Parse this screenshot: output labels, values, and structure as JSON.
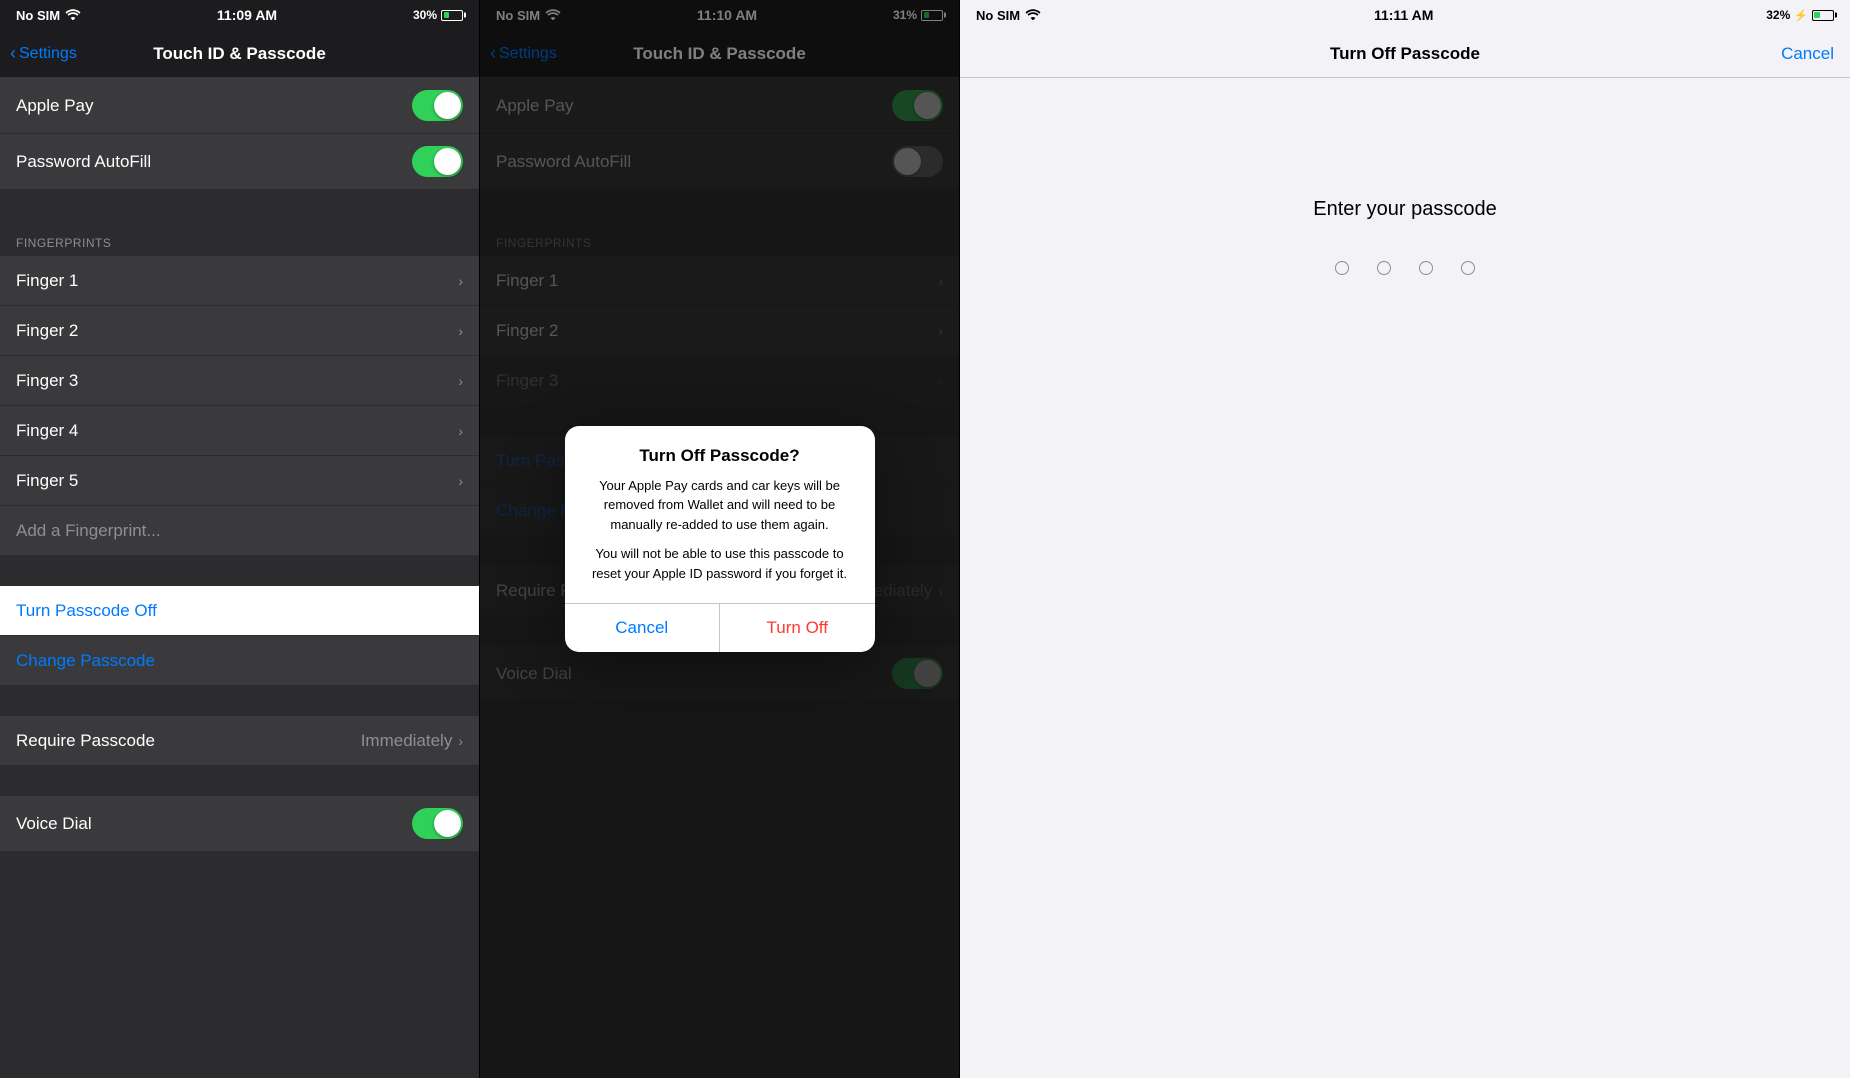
{
  "panel1": {
    "status": {
      "left": "No SIM",
      "time": "11:09 AM",
      "battery": "30%"
    },
    "nav": {
      "back": "Settings",
      "title": "Touch ID & Passcode"
    },
    "toggles": {
      "apple_pay": {
        "label": "Apple Pay",
        "on": true
      },
      "password_autofill": {
        "label": "Password AutoFill",
        "on": true
      }
    },
    "fingerprints_header": "FINGERPRINTS",
    "fingerprints": [
      "Finger 1",
      "Finger 2",
      "Finger 3",
      "Finger 4",
      "Finger 5"
    ],
    "add_fingerprint": "Add a Fingerprint...",
    "turn_passcode_off": "Turn Passcode Off",
    "change_passcode": "Change Passcode",
    "require_passcode": {
      "label": "Require Passcode",
      "value": "Immediately"
    },
    "voice_dial": {
      "label": "Voice Dial",
      "on": true
    }
  },
  "panel2": {
    "status": {
      "left": "No SIM",
      "time": "11:10 AM",
      "battery": "31%"
    },
    "nav": {
      "back": "Settings",
      "title": "Touch ID & Passcode"
    },
    "toggles": {
      "apple_pay": {
        "label": "Apple Pay",
        "on": true
      },
      "password_autofill": {
        "label": "Password AutoFill",
        "on": false
      }
    },
    "fingerprints_header": "FINGERPRINTS",
    "fingerprints": [
      "Finger 1",
      "Finger 2"
    ],
    "turn_passcode_off": "Turn Passcode Off",
    "change_passcode": "Change Passcode",
    "require_passcode": {
      "label": "Require Passcode",
      "value": "Immediately"
    },
    "voice_dial": {
      "label": "Voice Dial",
      "on": true
    }
  },
  "modal": {
    "title": "Turn Off Passcode?",
    "message1": "Your Apple Pay cards and car keys will be removed from Wallet and will need to be manually re-added to use them again.",
    "message2": "You will not be able to use this passcode to reset your Apple ID password if you forget it.",
    "cancel": "Cancel",
    "turn_off": "Turn Off"
  },
  "panel3": {
    "status": {
      "left": "No SIM",
      "time": "11:11 AM",
      "battery": "32%"
    },
    "nav": {
      "title": "Turn Off Passcode",
      "cancel": "Cancel"
    },
    "prompt": "Enter your passcode",
    "dots": 4
  },
  "icons": {
    "back_chevron": "‹",
    "chevron_right": "›",
    "wifi": "▲",
    "battery_charging": "⚡"
  }
}
